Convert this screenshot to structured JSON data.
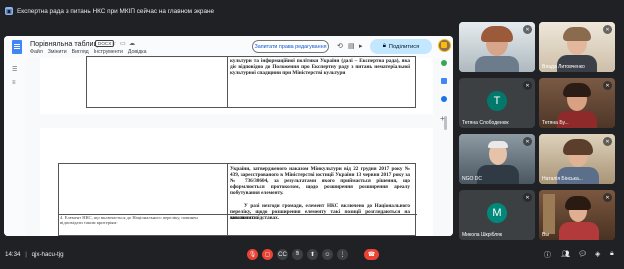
{
  "banner": {
    "text": "Експертна рада з питань НКС при МКІП сейчас на главном экране"
  },
  "doc": {
    "title": "Порівняльна таблиця",
    "badge": "DOCX",
    "menu": [
      "Файл",
      "Змінити",
      "Вигляд",
      "Інструменти",
      "Довідка"
    ],
    "request_access": "Запитати права редагування",
    "share": "Поділитися",
    "text_top": "культури та інформаційної політики України (далі – Експертна рада), яка діє відповідно до Положення про Експертну раду з питань нематеріальної культурної спадщини при Міністерстві культури",
    "text_mid": "України, затвердженого наказом Мінкультури від 22 грудня 2017 року № 439, зареєстрованого в Міністерстві юстиції України 13 червня 2017 року за № 736/30604, за результатами якого приймається рішення, що оформлюється протоколом, щодо розширення розширення ареалу побутування елементу.",
    "text_mid2": "У разі незгоди громади, елемент НКС включено до Національного переліку, щодо розширення елементу такі позиції розглядаються на загальних підставах.",
    "text_left_row": "4. Елемент НКС, що включається до Національного переліку, повинен відповідати таким критеріям:",
    "text_right_row": "виключити."
  },
  "participants": [
    {
      "name": "",
      "kind": "video"
    },
    {
      "name": "Влада Литовченко",
      "kind": "video"
    },
    {
      "name": "Тетяна Слободенюк",
      "kind": "letter",
      "letter": "T"
    },
    {
      "name": "Тетяна Бу...",
      "kind": "video"
    },
    {
      "name": "NGO DC",
      "kind": "video"
    },
    {
      "name": "Наталія Бінська...",
      "kind": "video"
    },
    {
      "name": "Микола Шкрібляк",
      "kind": "letter",
      "letter": "M"
    },
    {
      "name": "Вы",
      "kind": "video"
    }
  ],
  "bottom": {
    "time": "14:34",
    "meeting_code": "qjx-hacu-tjg"
  }
}
